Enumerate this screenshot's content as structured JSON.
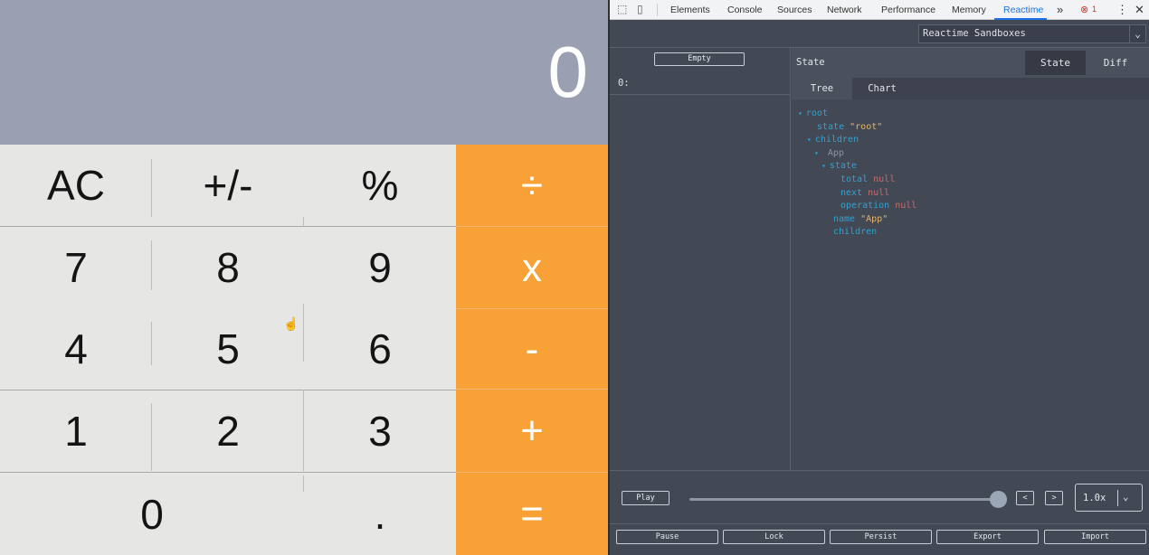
{
  "calculator": {
    "display": "0",
    "keys": {
      "ac": "AC",
      "sign": "+/-",
      "percent": "%",
      "divide": "÷",
      "seven": "7",
      "eight": "8",
      "nine": "9",
      "multiply": "x",
      "four": "4",
      "five": "5",
      "six": "6",
      "subtract": "-",
      "one": "1",
      "two": "2",
      "three": "3",
      "add": "+",
      "zero": "0",
      "decimal": ".",
      "equals": "="
    },
    "colors": {
      "display_bg": "#9aa0b1",
      "key_bg": "#e6e6e4",
      "operator_bg": "#f8a136"
    }
  },
  "devtools": {
    "tabs": [
      "Elements",
      "Console",
      "Sources",
      "Network",
      "Performance",
      "Memory",
      "Reactime"
    ],
    "active_tab": "Reactime",
    "more_tabs": "»",
    "error_count": "1",
    "sandbox_select": "Reactime Sandboxes",
    "left_panel": {
      "empty_button": "Empty",
      "snapshot_label": "0:"
    },
    "state_panel": {
      "title": "State",
      "view_buttons": [
        "State",
        "Diff"
      ],
      "subtabs": [
        "Tree",
        "Chart"
      ],
      "tree": {
        "root": "root",
        "state_key": "state",
        "state_val": "\"root\"",
        "children_key": "children",
        "app": "App",
        "app_state": "state",
        "total_key": "total",
        "total_val": "null",
        "next_key": "next",
        "next_val": "null",
        "operation_key": "operation",
        "operation_val": "null",
        "name_key": "name",
        "name_val": "\"App\"",
        "children2_key": "children"
      }
    },
    "controls": {
      "play": "Play",
      "prev": "<",
      "next": ">",
      "speed": "1.0x",
      "slider_fraction": 1.0
    },
    "footer_buttons": [
      "Pause",
      "Lock",
      "Persist",
      "Export",
      "Import"
    ]
  }
}
